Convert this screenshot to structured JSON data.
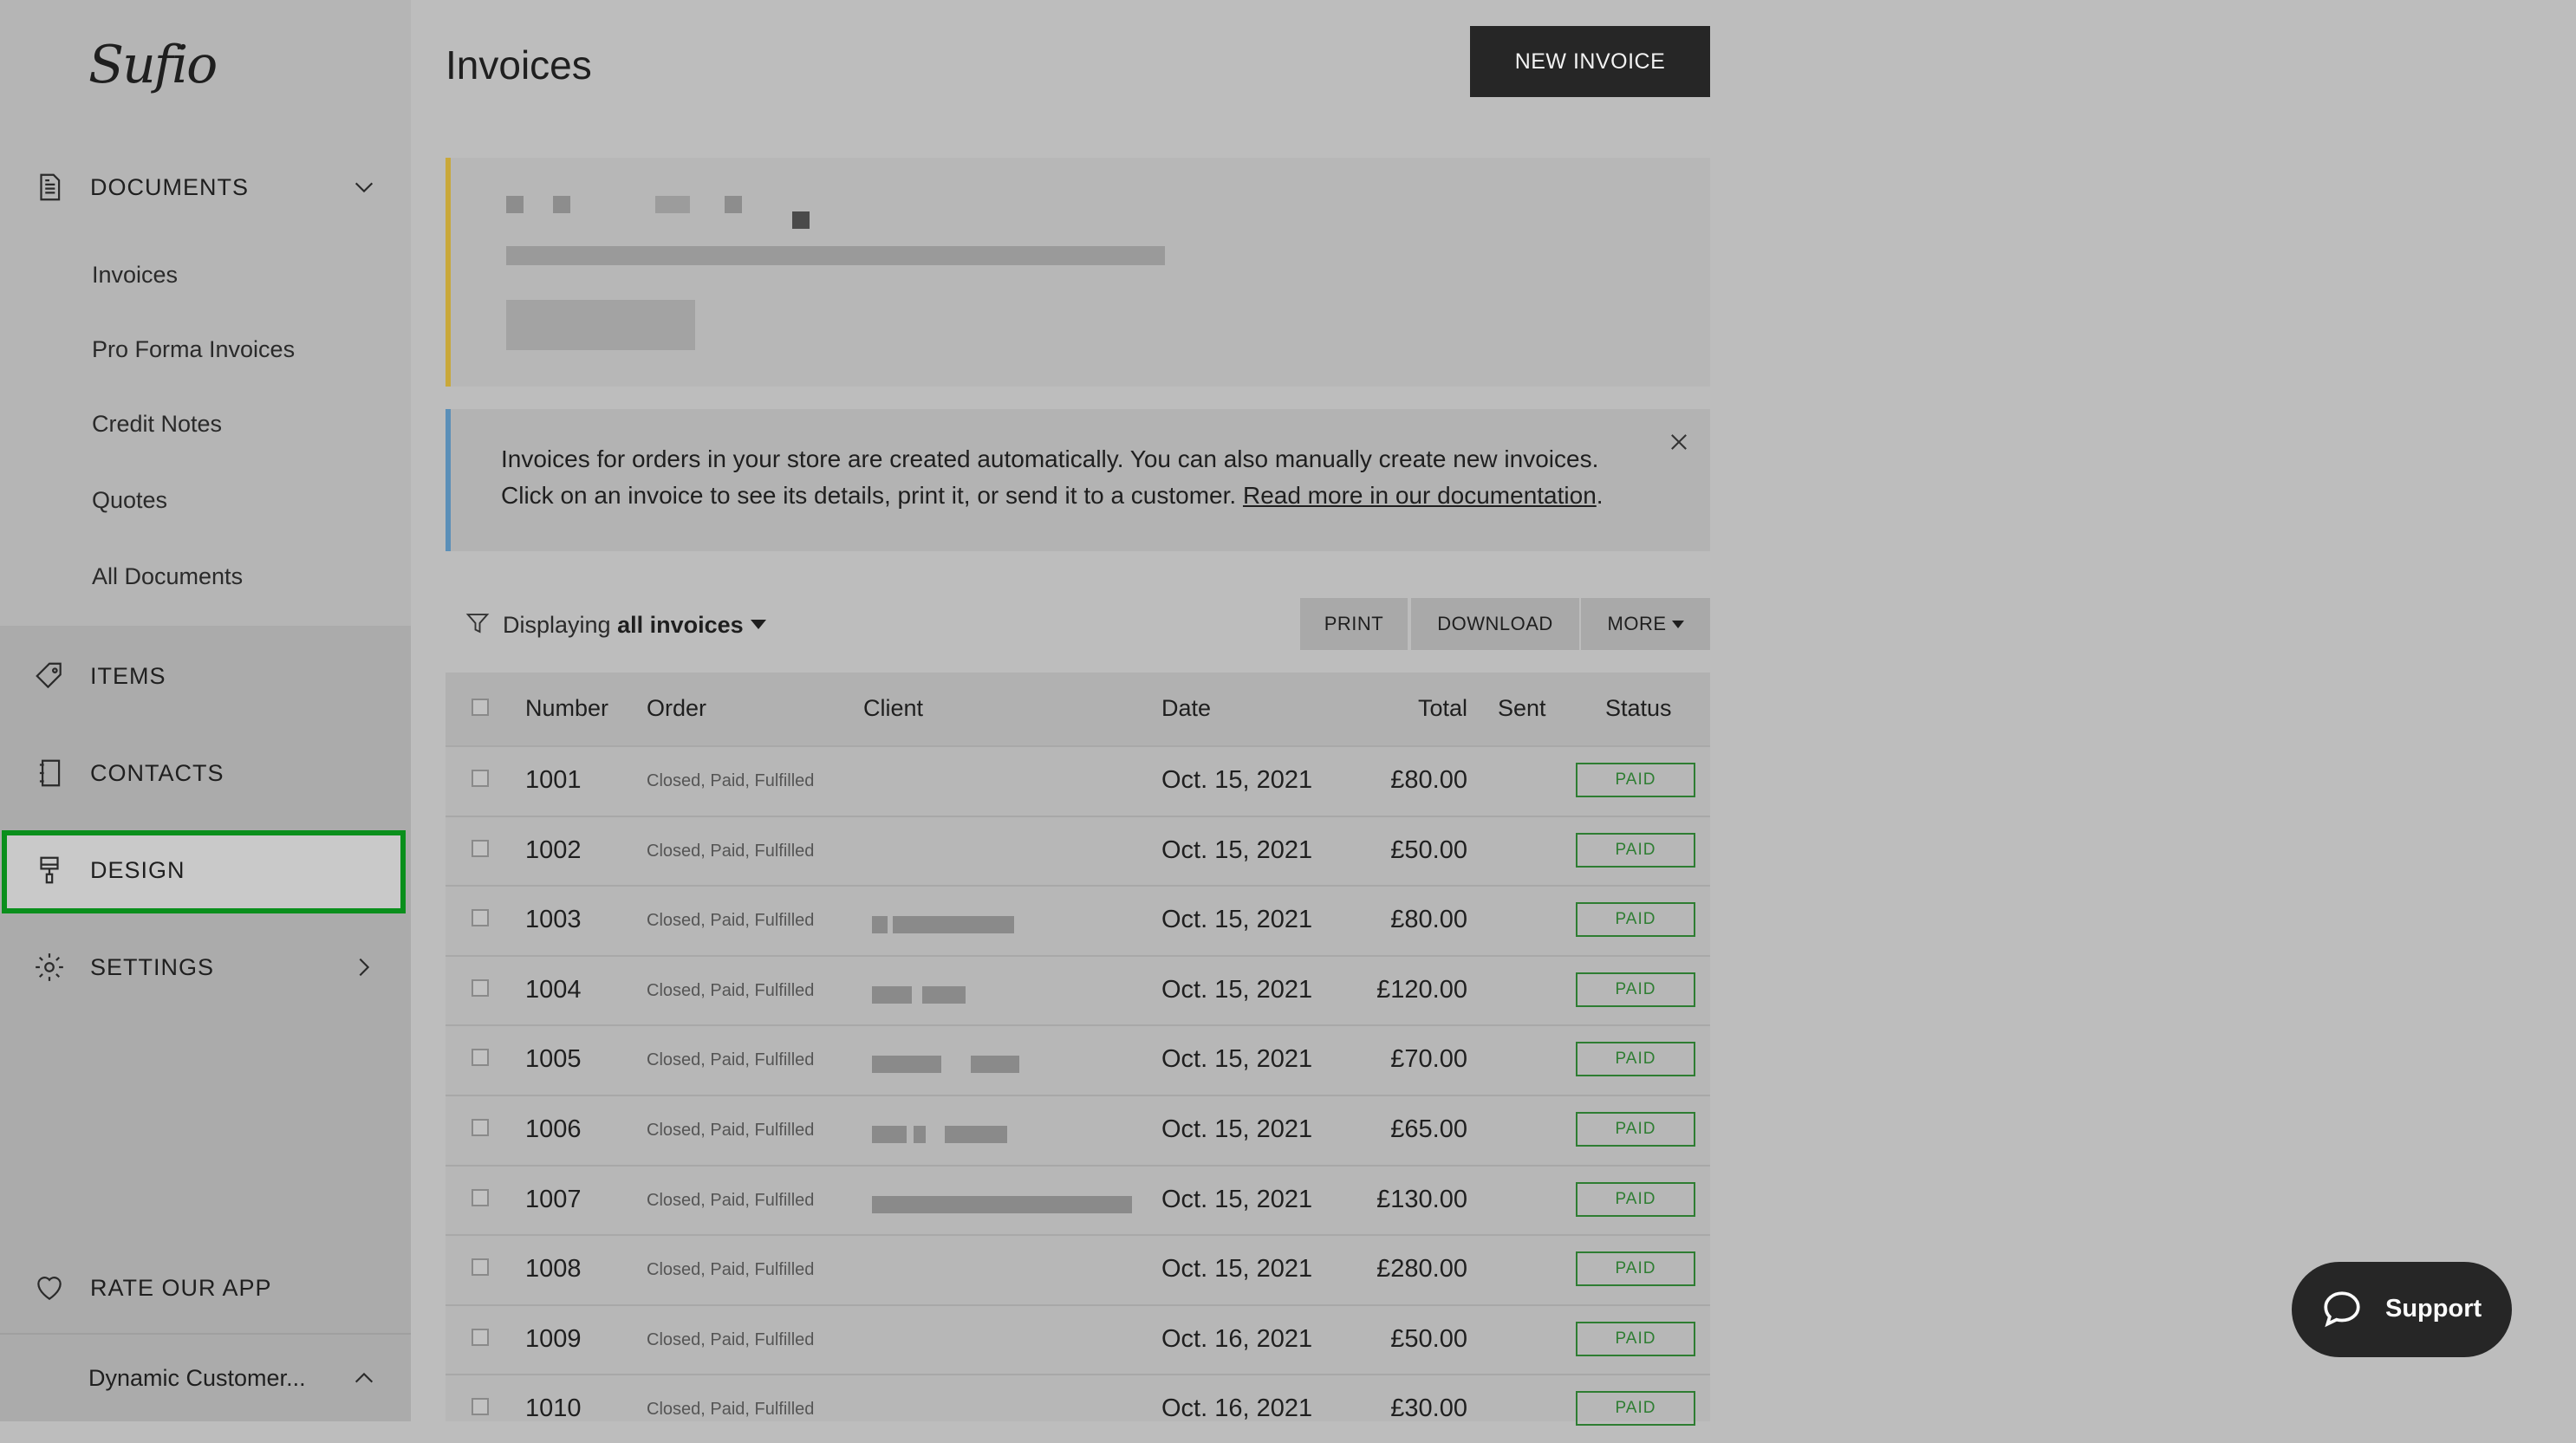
{
  "app": {
    "logo_text": "Sufio"
  },
  "sidebar": {
    "documents_label": "DOCUMENTS",
    "sub_items": [
      "Invoices",
      "Pro Forma Invoices",
      "Credit Notes",
      "Quotes",
      "All Documents"
    ],
    "items_label": "ITEMS",
    "contacts_label": "CONTACTS",
    "design_label": "DESIGN",
    "settings_label": "SETTINGS",
    "rate_label": "RATE OUR APP",
    "store_label": "Dynamic Customer..."
  },
  "header": {
    "title": "Invoices",
    "new_button": "NEW INVOICE"
  },
  "info": {
    "line1": "Invoices for orders in your store are created automatically. You can also manually create new invoices.",
    "line2_prefix": "Click on an invoice to see its details, print it, or send it to a customer. ",
    "link": "Read more in our documentation",
    "line2_suffix": "."
  },
  "toolbar": {
    "displaying": "Displaying",
    "filter_value": "all invoices",
    "print": "PRINT",
    "download": "DOWNLOAD",
    "more": "MORE"
  },
  "table": {
    "headers": {
      "number": "Number",
      "order": "Order",
      "client": "Client",
      "date": "Date",
      "total": "Total",
      "sent": "Sent",
      "status": "Status"
    },
    "rows": [
      {
        "number": "1001",
        "order": "Closed, Paid, Fulfilled",
        "date": "Oct. 15, 2021",
        "total": "£80.00",
        "status": "PAID"
      },
      {
        "number": "1002",
        "order": "Closed, Paid, Fulfilled",
        "date": "Oct. 15, 2021",
        "total": "£50.00",
        "status": "PAID"
      },
      {
        "number": "1003",
        "order": "Closed, Paid, Fulfilled",
        "date": "Oct. 15, 2021",
        "total": "£80.00",
        "status": "PAID"
      },
      {
        "number": "1004",
        "order": "Closed, Paid, Fulfilled",
        "date": "Oct. 15, 2021",
        "total": "£120.00",
        "status": "PAID"
      },
      {
        "number": "1005",
        "order": "Closed, Paid, Fulfilled",
        "date": "Oct. 15, 2021",
        "total": "£70.00",
        "status": "PAID"
      },
      {
        "number": "1006",
        "order": "Closed, Paid, Fulfilled",
        "date": "Oct. 15, 2021",
        "total": "£65.00",
        "status": "PAID"
      },
      {
        "number": "1007",
        "order": "Closed, Paid, Fulfilled",
        "date": "Oct. 15, 2021",
        "total": "£130.00",
        "status": "PAID"
      },
      {
        "number": "1008",
        "order": "Closed, Paid, Fulfilled",
        "date": "Oct. 15, 2021",
        "total": "£280.00",
        "status": "PAID"
      },
      {
        "number": "1009",
        "order": "Closed, Paid, Fulfilled",
        "date": "Oct. 16, 2021",
        "total": "£50.00",
        "status": "PAID"
      },
      {
        "number": "1010",
        "order": "Closed, Paid, Fulfilled",
        "date": "Oct. 16, 2021",
        "total": "£30.00",
        "status": "PAID"
      }
    ]
  },
  "support": {
    "label": "Support"
  },
  "colors": {
    "highlight": "#0a8f1c",
    "paid": "#2e7d32",
    "warning_bar": "#c9a83a",
    "info_bar": "#5a8fb8"
  },
  "icons": [
    "document-icon",
    "tag-icon",
    "contacts-icon",
    "paint-roller-icon",
    "gear-icon",
    "heart-icon",
    "chat-bubble-icon",
    "filter-icon",
    "close-icon"
  ]
}
